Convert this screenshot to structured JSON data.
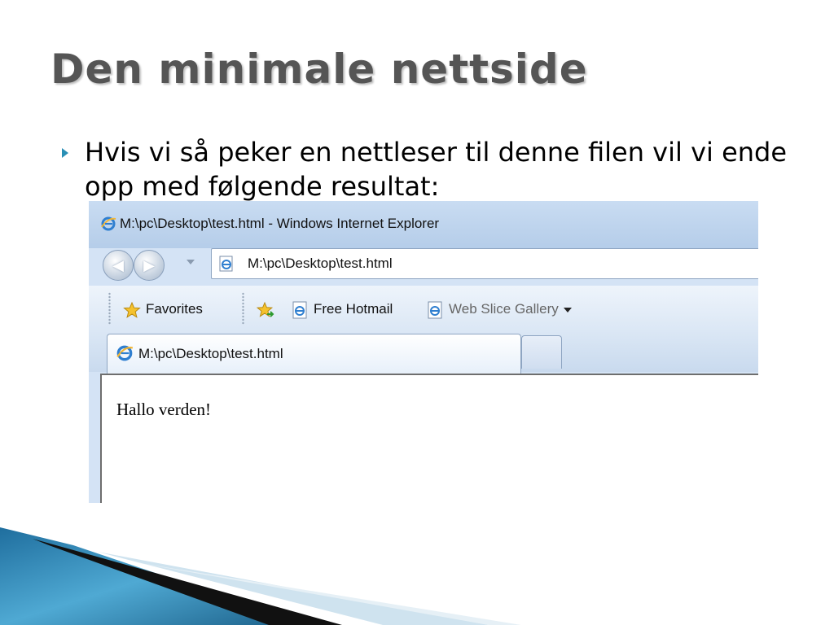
{
  "slide": {
    "title": "Den minimale nettside",
    "bullet": "Hvis vi så peker en nettleser til denne filen vil vi ende opp med følgende resultat:"
  },
  "browser": {
    "window_title": "M:\\pc\\Desktop\\test.html - Windows Internet Explorer",
    "address": "M:\\pc\\Desktop\\test.html",
    "favorites_bar": {
      "favorites_label": "Favorites",
      "links": [
        {
          "label": "Free Hotmail",
          "icon": "ie-page-icon"
        },
        {
          "label": "Web Slice Gallery",
          "icon": "ie-page-icon"
        }
      ]
    },
    "tab_label": "M:\\pc\\Desktop\\test.html",
    "page_content": "Hallo verden!"
  },
  "colors": {
    "title_gray": "#555555",
    "bullet_accent": "#2a8fb5",
    "decor_blue": "#2b7fb1"
  },
  "icons": [
    "bullet-arrow-icon",
    "ie-logo-icon",
    "back-arrow-icon",
    "forward-arrow-icon",
    "star-icon",
    "add-favorite-icon"
  ]
}
